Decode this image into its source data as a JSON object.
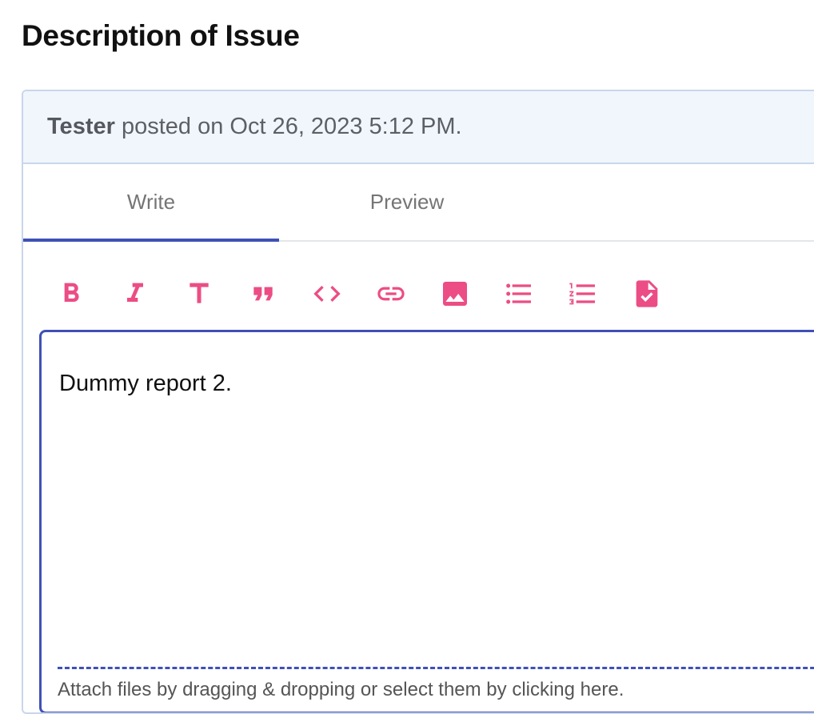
{
  "page": {
    "title": "Description of Issue"
  },
  "post": {
    "author": "Tester",
    "meta": " posted on Oct 26, 2023 5:12 PM."
  },
  "tabs": [
    {
      "label": "Write"
    },
    {
      "label": "Preview"
    }
  ],
  "toolbar": {
    "icons": [
      "bold-icon",
      "italic-icon",
      "header-icon",
      "quote-icon",
      "code-icon",
      "link-icon",
      "image-icon",
      "bulleted-list-icon",
      "numbered-list-icon",
      "task-list-icon"
    ]
  },
  "editor": {
    "text": "Dummy report 2.",
    "attach_hint": "Attach files by dragging & dropping or select them by clicking here."
  },
  "colors": {
    "accent": "#3f51b5",
    "toolbar_icon": "#ec4d84",
    "header_bg": "#f1f6fd"
  }
}
